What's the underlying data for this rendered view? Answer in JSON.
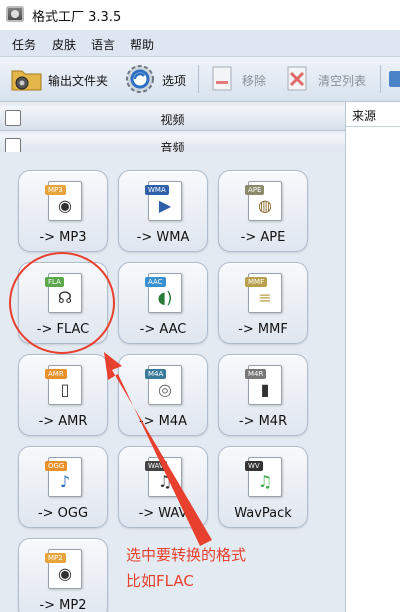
{
  "window": {
    "title": "格式工厂 3.3.5"
  },
  "menu": {
    "items": [
      "任务",
      "皮肤",
      "语言",
      "帮助"
    ]
  },
  "toolbar": {
    "output_folder": "输出文件夹",
    "options": "选项",
    "remove": "移除",
    "clear_list": "清空列表"
  },
  "categories": {
    "video": "视频",
    "audio": "音频"
  },
  "formats": [
    {
      "tag": "MP3",
      "label": "-> MP3",
      "icon": "speaker-icon",
      "tag_color": "#e8a23a"
    },
    {
      "tag": "WMA",
      "label": "-> WMA",
      "icon": "play-disc-icon",
      "tag_color": "#2f5fa8"
    },
    {
      "tag": "APE",
      "label": "-> APE",
      "icon": "speaker-pair-icon",
      "tag_color": "#8a8a6a"
    },
    {
      "tag": "FLA",
      "label": "-> FLAC",
      "icon": "headphones-icon",
      "tag_color": "#5aa84a"
    },
    {
      "tag": "AAC",
      "label": "-> AAC",
      "icon": "speaker-sound-icon",
      "tag_color": "#3a8fd0"
    },
    {
      "tag": "MMF",
      "label": "-> MMF",
      "icon": "document-icon",
      "tag_color": "#b8a04a"
    },
    {
      "tag": "AMR",
      "label": "-> AMR",
      "icon": "phone-icon",
      "tag_color": "#e8902a"
    },
    {
      "tag": "M4A",
      "label": "-> M4A",
      "icon": "disc-icon",
      "tag_color": "#3a7a9a"
    },
    {
      "tag": "M4R",
      "label": "-> M4R",
      "icon": "phone-icon",
      "tag_color": "#777777"
    },
    {
      "tag": "OGG",
      "label": "-> OGG",
      "icon": "music-note-icon",
      "tag_color": "#e8902a"
    },
    {
      "tag": "WAV",
      "label": "-> WAV",
      "icon": "music-notes-icon",
      "tag_color": "#444444"
    },
    {
      "tag": "WV",
      "label": "WavPack",
      "icon": "green-note-icon",
      "tag_color": "#333333"
    },
    {
      "tag": "MP2",
      "label": "-> MP2",
      "icon": "speaker-icon",
      "tag_color": "#e8a23a"
    }
  ],
  "right_panel": {
    "source_header": "来源"
  },
  "annotation": {
    "line1": "选中要转换的格式",
    "line2": "比如FLAC",
    "color": "#e8402e"
  }
}
